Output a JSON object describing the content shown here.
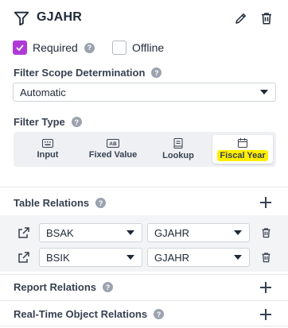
{
  "header": {
    "title": "GJAHR",
    "icons": {
      "filter": "filter-icon",
      "edit": "pencil-icon",
      "delete": "trash-icon"
    }
  },
  "options": {
    "required": {
      "label": "Required",
      "checked": true
    },
    "offline": {
      "label": "Offline",
      "checked": false
    },
    "help_glyph": "?"
  },
  "scope": {
    "label": "Filter Scope Determination",
    "value": "Automatic"
  },
  "filter_type": {
    "label": "Filter Type",
    "options": [
      {
        "label": "Input",
        "icon": "keyboard-icon"
      },
      {
        "label": "Fixed Value",
        "icon": "ab-icon"
      },
      {
        "label": "Lookup",
        "icon": "book-icon"
      },
      {
        "label": "Fiscal Year",
        "icon": "calendar-icon"
      }
    ],
    "selected": "Fiscal Year"
  },
  "table_relations": {
    "label": "Table Relations",
    "rows": [
      {
        "table": "BSAK",
        "field": "GJAHR"
      },
      {
        "table": "BSIK",
        "field": "GJAHR"
      }
    ]
  },
  "report_relations": {
    "label": "Report Relations"
  },
  "realtime_relations": {
    "label": "Real-Time Object Relations"
  },
  "colors": {
    "accent": "#b03ad6",
    "highlight": "#ffee00",
    "panel": "#eef0f3"
  }
}
